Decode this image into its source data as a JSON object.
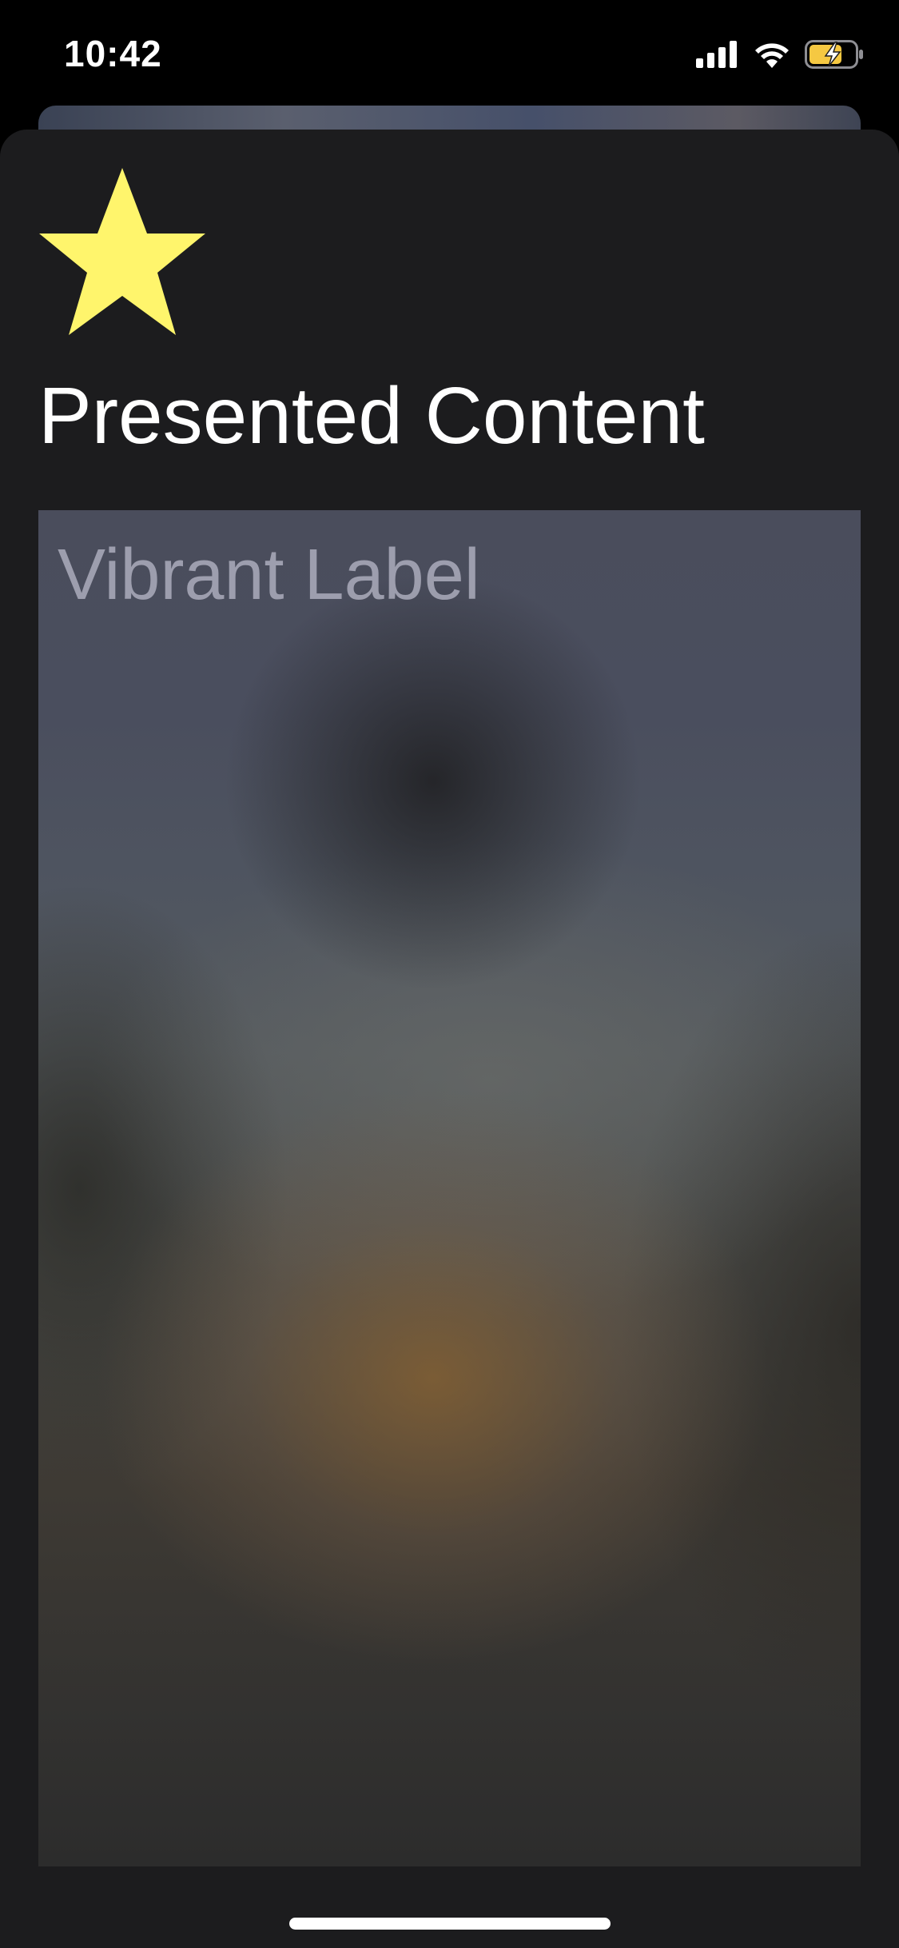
{
  "status_bar": {
    "time": "10:42",
    "icons": [
      "cellular-signal-icon",
      "wifi-icon",
      "battery-charging-icon"
    ]
  },
  "sheet": {
    "icon": "star-icon",
    "icon_color": "#FFF56C",
    "title": "Presented Content",
    "vibrant_label": "Vibrant Label"
  },
  "colors": {
    "sheet_background": "#1C1C1E",
    "battery_fill": "#F5C842"
  }
}
